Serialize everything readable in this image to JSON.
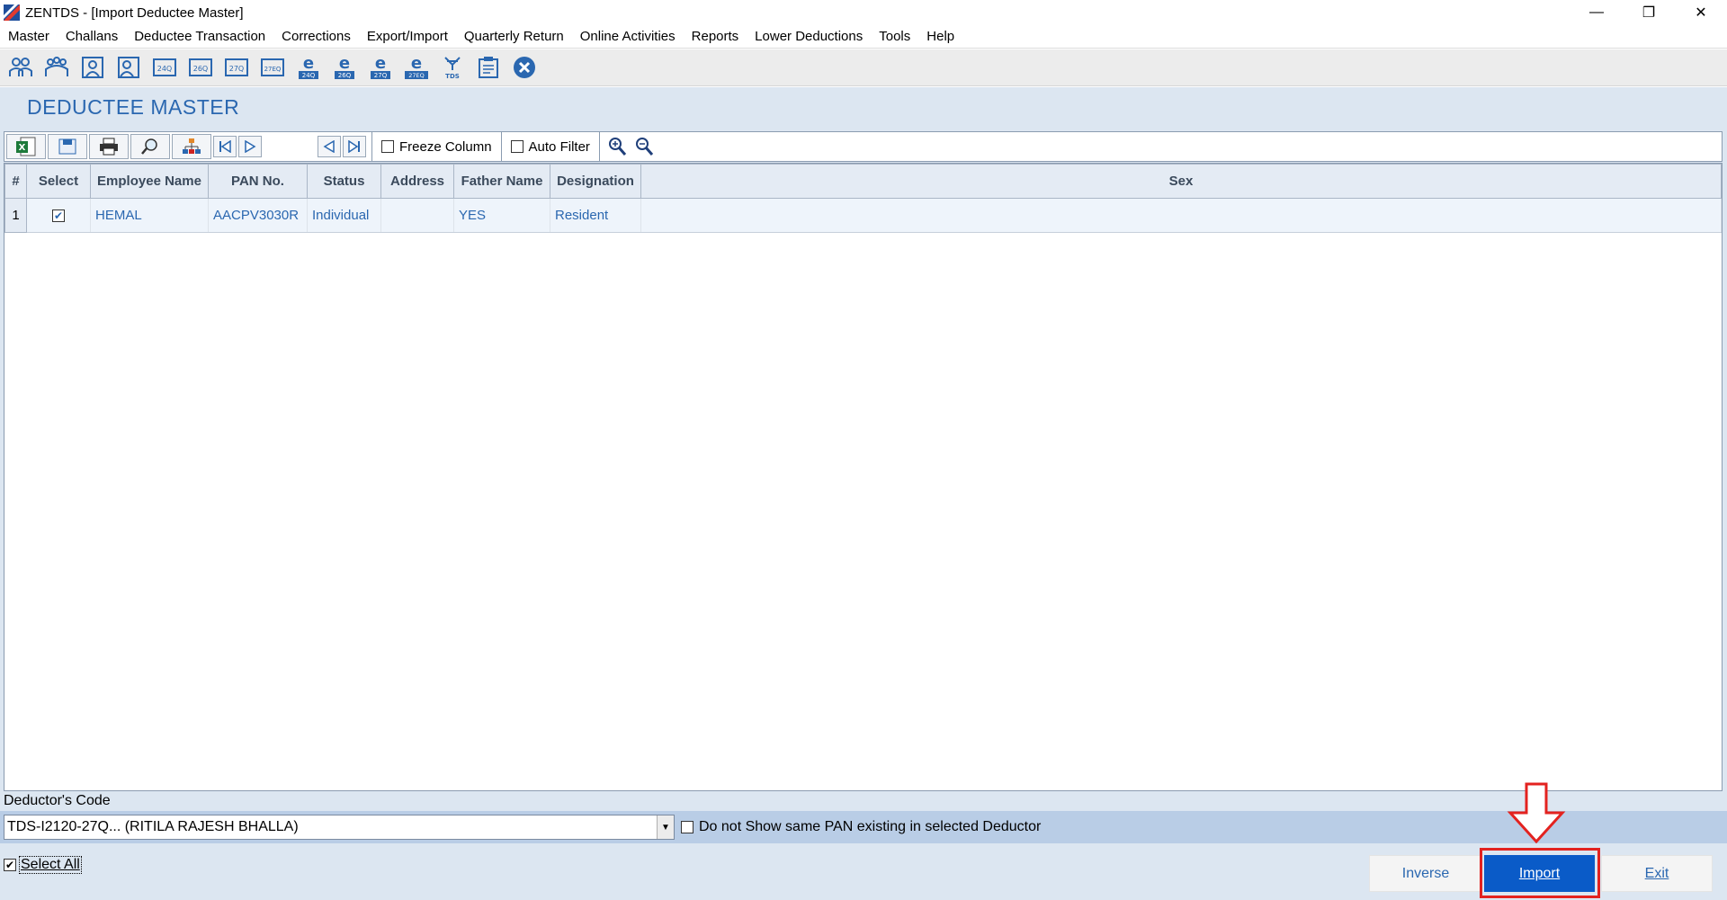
{
  "window": {
    "title": "ZENTDS - [Import Deductee Master]",
    "minimize_glyph": "—",
    "restore_glyph": "❐",
    "close_glyph": "✕"
  },
  "menu": [
    "Master",
    "Challans",
    "Deductee Transaction",
    "Corrections",
    "Export/Import",
    "Quarterly Return",
    "Online Activities",
    "Reports",
    "Lower Deductions",
    "Tools",
    "Help"
  ],
  "toolbar_icons": [
    {
      "name": "deductor-icon",
      "label": ""
    },
    {
      "name": "deductee-group-icon",
      "label": ""
    },
    {
      "name": "deductee-icon",
      "label": ""
    },
    {
      "name": "employee-icon",
      "label": ""
    },
    {
      "name": "form-24q-icon",
      "label": "24Q"
    },
    {
      "name": "form-26q-icon",
      "label": "26Q"
    },
    {
      "name": "form-27q-icon",
      "label": "27Q"
    },
    {
      "name": "form-27eq-icon",
      "label": "27EQ"
    },
    {
      "name": "e-24q-icon",
      "label": "24Q"
    },
    {
      "name": "e-26q-icon",
      "label": "26Q"
    },
    {
      "name": "e-27q-icon",
      "label": "27Q"
    },
    {
      "name": "e-27eq-icon",
      "label": "27EQ"
    },
    {
      "name": "tds-icon",
      "label": "TDS"
    },
    {
      "name": "document-icon",
      "label": ""
    },
    {
      "name": "close-circle-icon",
      "label": ""
    }
  ],
  "page": {
    "title": "DEDUCTEE MASTER"
  },
  "grid_toolbar": {
    "freeze_column": "Freeze Column",
    "auto_filter": "Auto Filter"
  },
  "grid": {
    "columns": [
      "#",
      "Select",
      "Employee Name",
      "PAN No.",
      "Status",
      "Address",
      "Father Name",
      "Designation",
      "Sex"
    ],
    "rows": [
      {
        "num": "1",
        "selected": true,
        "employee_name": "HEMAL",
        "pan": "AACPV3030R",
        "status": "Individual",
        "address": "",
        "father_name": "YES",
        "designation": "Resident",
        "sex": ""
      }
    ]
  },
  "footer": {
    "deductor_label": "Deductor's Code",
    "deductor_value": "TDS-I2120-27Q... (RITILA RAJESH BHALLA)",
    "pan_option": "Do not Show same PAN existing in selected Deductor",
    "select_all": "Select All",
    "inverse": "Inverse",
    "import": "Import",
    "exit": "Exit"
  },
  "colors": {
    "accent": "#2a67b0",
    "import_button": "#0a5bc8",
    "highlight": "#e3221f",
    "page_background": "#dce6f1"
  }
}
